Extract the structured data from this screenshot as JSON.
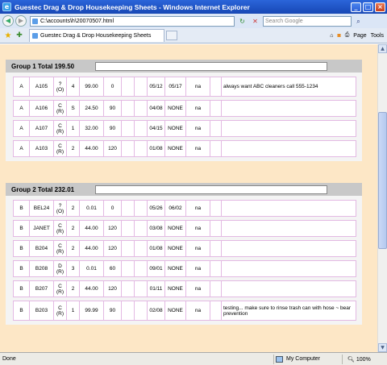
{
  "window": {
    "title": "Guestec Drag & Drop Housekeeping Sheets - Windows Internet Explorer"
  },
  "address": {
    "url": "C:\\accounts\\h\\20070507.html"
  },
  "search": {
    "placeholder": "Search Google"
  },
  "tab": {
    "label": "Guestec Drag & Drop Housekeeping Sheets"
  },
  "commands": {
    "page": "Page",
    "tools": "Tools"
  },
  "status": {
    "text": "Done",
    "zone": "My Computer",
    "zoom": "100%"
  },
  "groups": [
    {
      "title": "Group 1 Total 199.50",
      "rows": [
        [
          "A",
          "A105",
          "? (O)",
          "4",
          "99.00",
          "0",
          "",
          "",
          "05/12",
          "05/17",
          "na",
          "",
          "always want ABC cleaners call 555-1234"
        ],
        [
          "A",
          "A106",
          "C (R)",
          "S",
          "24.50",
          "90",
          "",
          "",
          "04/08",
          "NONE",
          "na",
          "",
          ""
        ],
        [
          "A",
          "A107",
          "C (R)",
          "1",
          "32.00",
          "90",
          "",
          "",
          "04/15",
          "NONE",
          "na",
          "",
          ""
        ],
        [
          "A",
          "A103",
          "C (R)",
          "2",
          "44.00",
          "120",
          "",
          "",
          "01/08",
          "NONE",
          "na",
          "",
          ""
        ]
      ]
    },
    {
      "title": "Group 2 Total 232.01",
      "rows": [
        [
          "B",
          "BEL24",
          "? (O)",
          "2",
          "0.01",
          "0",
          "",
          "",
          "05/26",
          "06/02",
          "na",
          "",
          ""
        ],
        [
          "B",
          "JANET",
          "C (R)",
          "2",
          "44.00",
          "120",
          "",
          "",
          "03/08",
          "NONE",
          "na",
          "",
          ""
        ],
        [
          "B",
          "B204",
          "C (R)",
          "2",
          "44.00",
          "120",
          "",
          "",
          "01/08",
          "NONE",
          "na",
          "",
          ""
        ],
        [
          "B",
          "B208",
          "D (R)",
          "3",
          "0.01",
          "60",
          "",
          "",
          "09/01",
          "NONE",
          "na",
          "",
          ""
        ],
        [
          "B",
          "B207",
          "C (R)",
          "2",
          "44.00",
          "120",
          "",
          "",
          "01/11",
          "NONE",
          "na",
          "",
          ""
        ],
        [
          "B",
          "B203",
          "C (R)",
          "1",
          "99.99",
          "90",
          "",
          "",
          "02/08",
          "NONE",
          "na",
          "",
          "testing... make sure to rinse trash can with hose ~ bear prevention"
        ]
      ]
    }
  ]
}
